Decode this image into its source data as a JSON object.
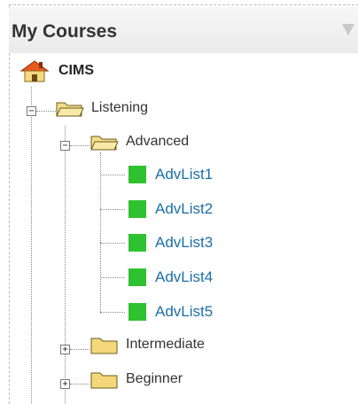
{
  "header": {
    "title": "My Courses"
  },
  "tree": {
    "root": {
      "label": "CIMS"
    },
    "listening": {
      "label": "Listening"
    },
    "advanced": {
      "label": "Advanced"
    },
    "lessons": [
      "AdvList1",
      "AdvList2",
      "AdvList3",
      "AdvList4",
      "AdvList5"
    ],
    "intermediate": {
      "label": "Intermediate"
    },
    "beginner": {
      "label": "Beginner"
    }
  },
  "colors": {
    "link": "#1b6fa8",
    "lesson_square": "#2fc230",
    "folder": "#f3d77a"
  }
}
